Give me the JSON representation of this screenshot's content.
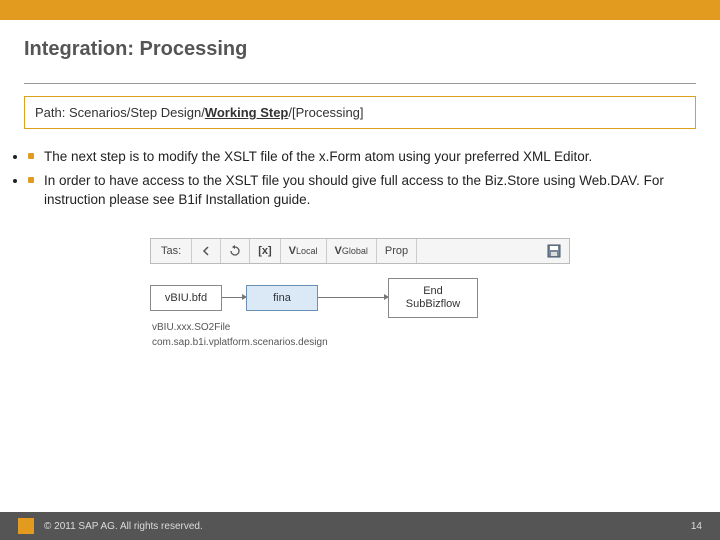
{
  "header": {
    "title": "Integration: Processing"
  },
  "path": {
    "label": "Path:  ",
    "seg1": "Scenarios/Step Design/",
    "seg2": "Working Step",
    "seg3": "/[Processing]"
  },
  "bullets": [
    "The next step is to modify the XSLT file of the x.Form atom using your preferred XML Editor.",
    "In order to have access to the XSLT file you should give full access to the Biz.Store using Web.DAV. For instruction please see B1if Installation guide."
  ],
  "toolbar": {
    "label": "Tas:",
    "local": "V",
    "local_sub": "Local",
    "global": "V",
    "global_sub": "Global",
    "prop": "Prop"
  },
  "flow": {
    "node1": "vBIU.bfd",
    "node2": "fina",
    "node3a": "End",
    "node3b": "SubBizflow",
    "below1": "vBIU.xxx.SO2File",
    "below2": "com.sap.b1i.vplatform.scenarios.design"
  },
  "footer": {
    "copyright": "© 2011 SAP AG. All rights reserved.",
    "page": "14"
  }
}
